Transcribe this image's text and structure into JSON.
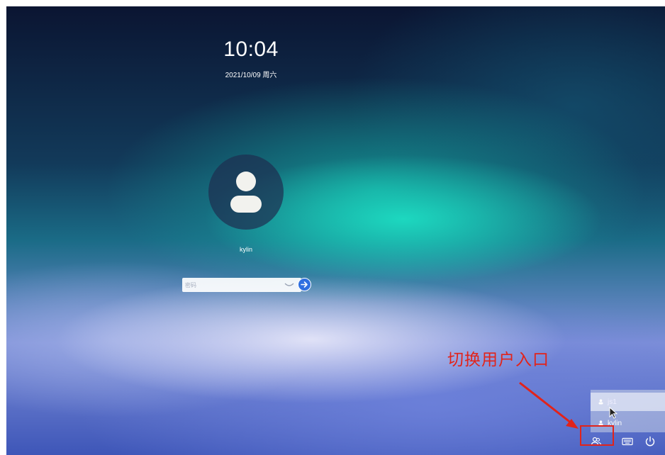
{
  "lockscreen": {
    "time": "10:04",
    "date": "2021/10/09 周六",
    "username": "kylin",
    "password_placeholder": "密码"
  },
  "annotation": {
    "label": "切换用户入口",
    "color": "#e2231a"
  },
  "user_switcher": {
    "users": [
      {
        "name": "js1",
        "selected": true
      },
      {
        "name": "kylin",
        "selected": false
      }
    ]
  },
  "tray": {
    "icons": [
      "switch-user-icon",
      "keyboard-icon",
      "power-icon"
    ]
  },
  "colors": {
    "submit_button": "#2f6fe0",
    "annotation": "#e2231a"
  }
}
